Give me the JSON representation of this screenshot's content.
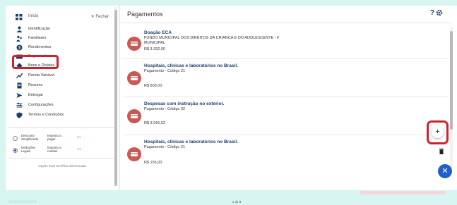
{
  "sidebar": {
    "home_label": "Início",
    "close_label": "✕ Fechar",
    "items": [
      {
        "label": "Identificação",
        "icon": "person-icon"
      },
      {
        "label": "Familiares",
        "icon": "family-icon"
      },
      {
        "label": "Rendimentos",
        "icon": "money-icon"
      },
      {
        "label": "Pagamentos",
        "icon": "payment-icon"
      },
      {
        "label": "Bens e Dívidas",
        "icon": "house-icon"
      },
      {
        "label": "Renda Variável",
        "icon": "chart-icon"
      },
      {
        "label": "Resumo",
        "icon": "document-icon"
      },
      {
        "label": "Entregar",
        "icon": "send-icon"
      },
      {
        "label": "Configurações",
        "icon": "settings-icon"
      },
      {
        "label": "Termos e Condições",
        "icon": "shield-icon"
      }
    ],
    "options": [
      {
        "name": "Desconto Simplificado",
        "tax": "Imposto a pagar",
        "value": "R$ ...",
        "selected": false
      },
      {
        "name": "Deduções Legais",
        "tax": "Imposto a restituir",
        "value": "R$ ...",
        "selected": true
      }
    ],
    "best_option": "Opção mais benéfica selecionada"
  },
  "main": {
    "title": "Pagamentos",
    "help": "?",
    "cards": [
      {
        "title": "Doação ECA",
        "lines": [
          "FUNDO MUNICIPAL DOS DIREITOS DA CRIANCA E DO ADOLESCENTE - F",
          "MUNICIPAL"
        ],
        "value": "R$ 3.392,00"
      },
      {
        "title": "Hospitais, clínicas e laboratórios no Brasil.",
        "lines": [
          "Pagamento - Código 21"
        ],
        "value": "R$ 800,00"
      },
      {
        "title": "Despesas com instrução no exterior.",
        "lines": [
          "Pagamento - Código 02"
        ],
        "value": "R$ 3.915,52"
      },
      {
        "title": "Hospitais, clínicas e laboratórios no Brasil.",
        "lines": [
          "Pagamento - Código 21"
        ],
        "value": "R$ 155,00"
      }
    ],
    "add_button": "+",
    "close_button": "✕",
    "pager": "1 de 8"
  }
}
